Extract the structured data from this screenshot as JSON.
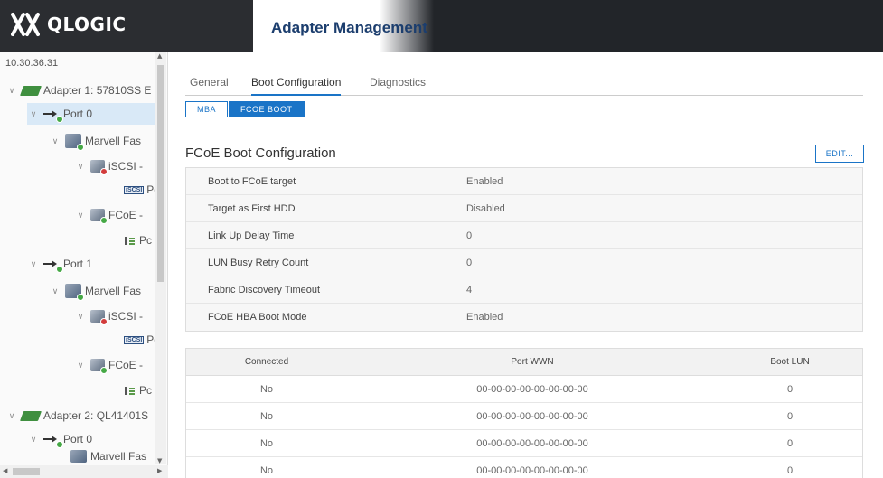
{
  "header": {
    "logo_text": "QLOGIC",
    "app_title": "Adapter Management"
  },
  "tree": {
    "host": "10.30.36.31",
    "rows": [
      {
        "label": "Adapter 1: 57810SS E",
        "icon": "adapter-icon",
        "expand": "∨"
      },
      {
        "label": "Port 0",
        "icon": "port-icon",
        "expand": "∨"
      },
      {
        "label": "Marvell Fas",
        "icon": "function-icon",
        "expand": "∨"
      },
      {
        "label": "iSCSI -",
        "icon": "iscsi-function-icon",
        "expand": "∨"
      },
      {
        "label": "Pc",
        "icon": "iscsi-port-icon"
      },
      {
        "label": "FCoE -",
        "icon": "fcoe-function-icon",
        "expand": "∨"
      },
      {
        "label": "Pc",
        "icon": "fc-port-icon"
      },
      {
        "label": "Port 1",
        "icon": "port-icon",
        "expand": "∨"
      },
      {
        "label": "Marvell Fas",
        "icon": "function-icon",
        "expand": "∨"
      },
      {
        "label": "iSCSI -",
        "icon": "iscsi-function-icon",
        "expand": "∨"
      },
      {
        "label": "Pc",
        "icon": "iscsi-port-icon"
      },
      {
        "label": "FCoE -",
        "icon": "fcoe-function-icon",
        "expand": "∨"
      },
      {
        "label": "Pc",
        "icon": "fc-port-icon"
      },
      {
        "label": "Adapter 2: QL41401S",
        "icon": "adapter-icon",
        "expand": "∨"
      },
      {
        "label": "Port 0",
        "icon": "port-icon",
        "expand": "∨"
      },
      {
        "label": "Marvell Fas",
        "icon": "function-icon"
      }
    ],
    "iscsi_icon_text": "iSCSI"
  },
  "tabs": [
    {
      "label": "General"
    },
    {
      "label": "Boot Configuration"
    },
    {
      "label": "Diagnostics"
    }
  ],
  "subtabs": [
    {
      "label": "MBA"
    },
    {
      "label": "FCOE BOOT"
    }
  ],
  "section": {
    "title": "FCoE Boot Configuration",
    "edit_label": "EDIT..."
  },
  "properties": [
    {
      "name": "Boot to FCoE target",
      "value": "Enabled"
    },
    {
      "name": "Target as First HDD",
      "value": "Disabled"
    },
    {
      "name": "Link Up Delay Time",
      "value": "0"
    },
    {
      "name": "LUN Busy Retry Count",
      "value": "0"
    },
    {
      "name": "Fabric Discovery Timeout",
      "value": "4"
    },
    {
      "name": "FCoE HBA Boot Mode",
      "value": "Enabled"
    }
  ],
  "wwn_table": {
    "headers": [
      "Connected",
      "Port WWN",
      "Boot LUN"
    ],
    "rows": [
      [
        "No",
        "00-00-00-00-00-00-00-00",
        "0"
      ],
      [
        "No",
        "00-00-00-00-00-00-00-00",
        "0"
      ],
      [
        "No",
        "00-00-00-00-00-00-00-00",
        "0"
      ],
      [
        "No",
        "00-00-00-00-00-00-00-00",
        "0"
      ]
    ]
  },
  "colors": {
    "accent": "#1a74c7",
    "header_bg": "#222529",
    "brand_text": "#1c3e6e"
  }
}
